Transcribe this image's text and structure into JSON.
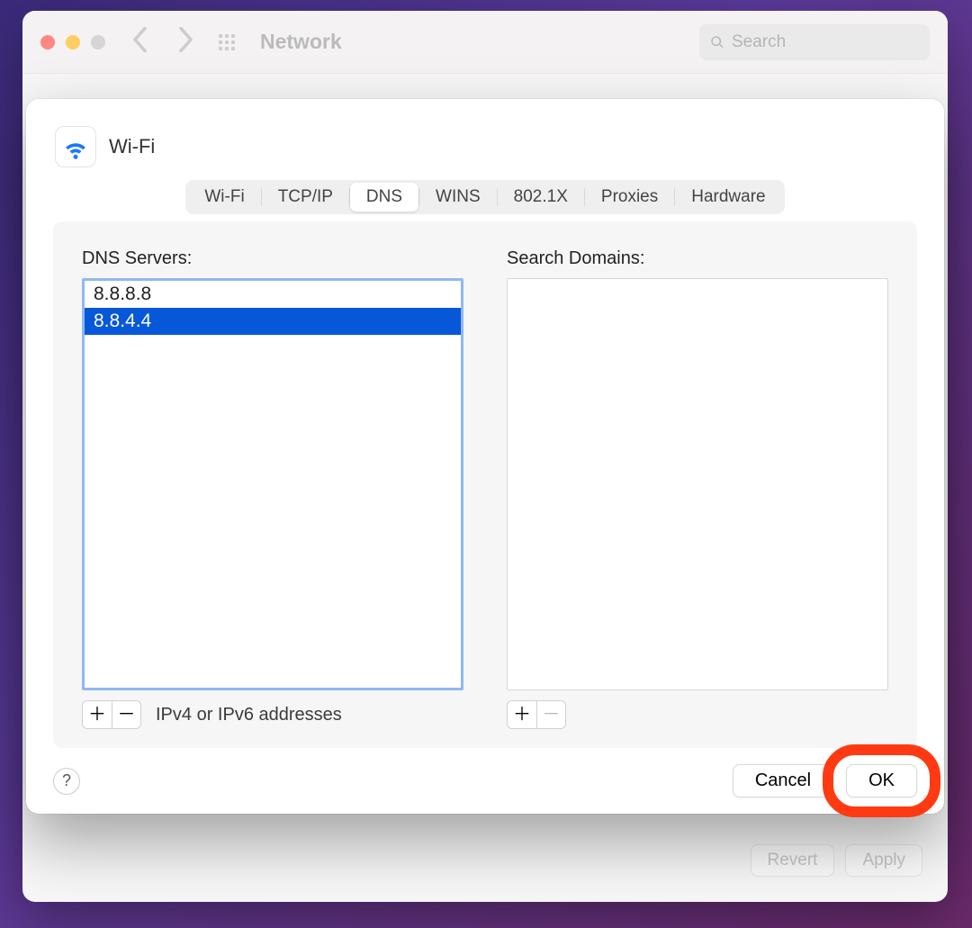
{
  "window": {
    "title": "Network",
    "search_placeholder": "Search",
    "footer": {
      "revert": "Revert",
      "apply": "Apply"
    }
  },
  "sheet": {
    "title": "Wi-Fi",
    "tabs": {
      "wifi": "Wi-Fi",
      "tcpip": "TCP/IP",
      "dns": "DNS",
      "wins": "WINS",
      "8021x": "802.1X",
      "proxies": "Proxies",
      "hardware": "Hardware"
    },
    "dns": {
      "label": "DNS Servers:",
      "servers": [
        "8.8.8.8",
        "8.8.4.4"
      ],
      "selected_index": 1,
      "hint": "IPv4 or IPv6 addresses"
    },
    "search_domains": {
      "label": "Search Domains:",
      "domains": []
    },
    "buttons": {
      "cancel": "Cancel",
      "ok": "OK"
    }
  }
}
